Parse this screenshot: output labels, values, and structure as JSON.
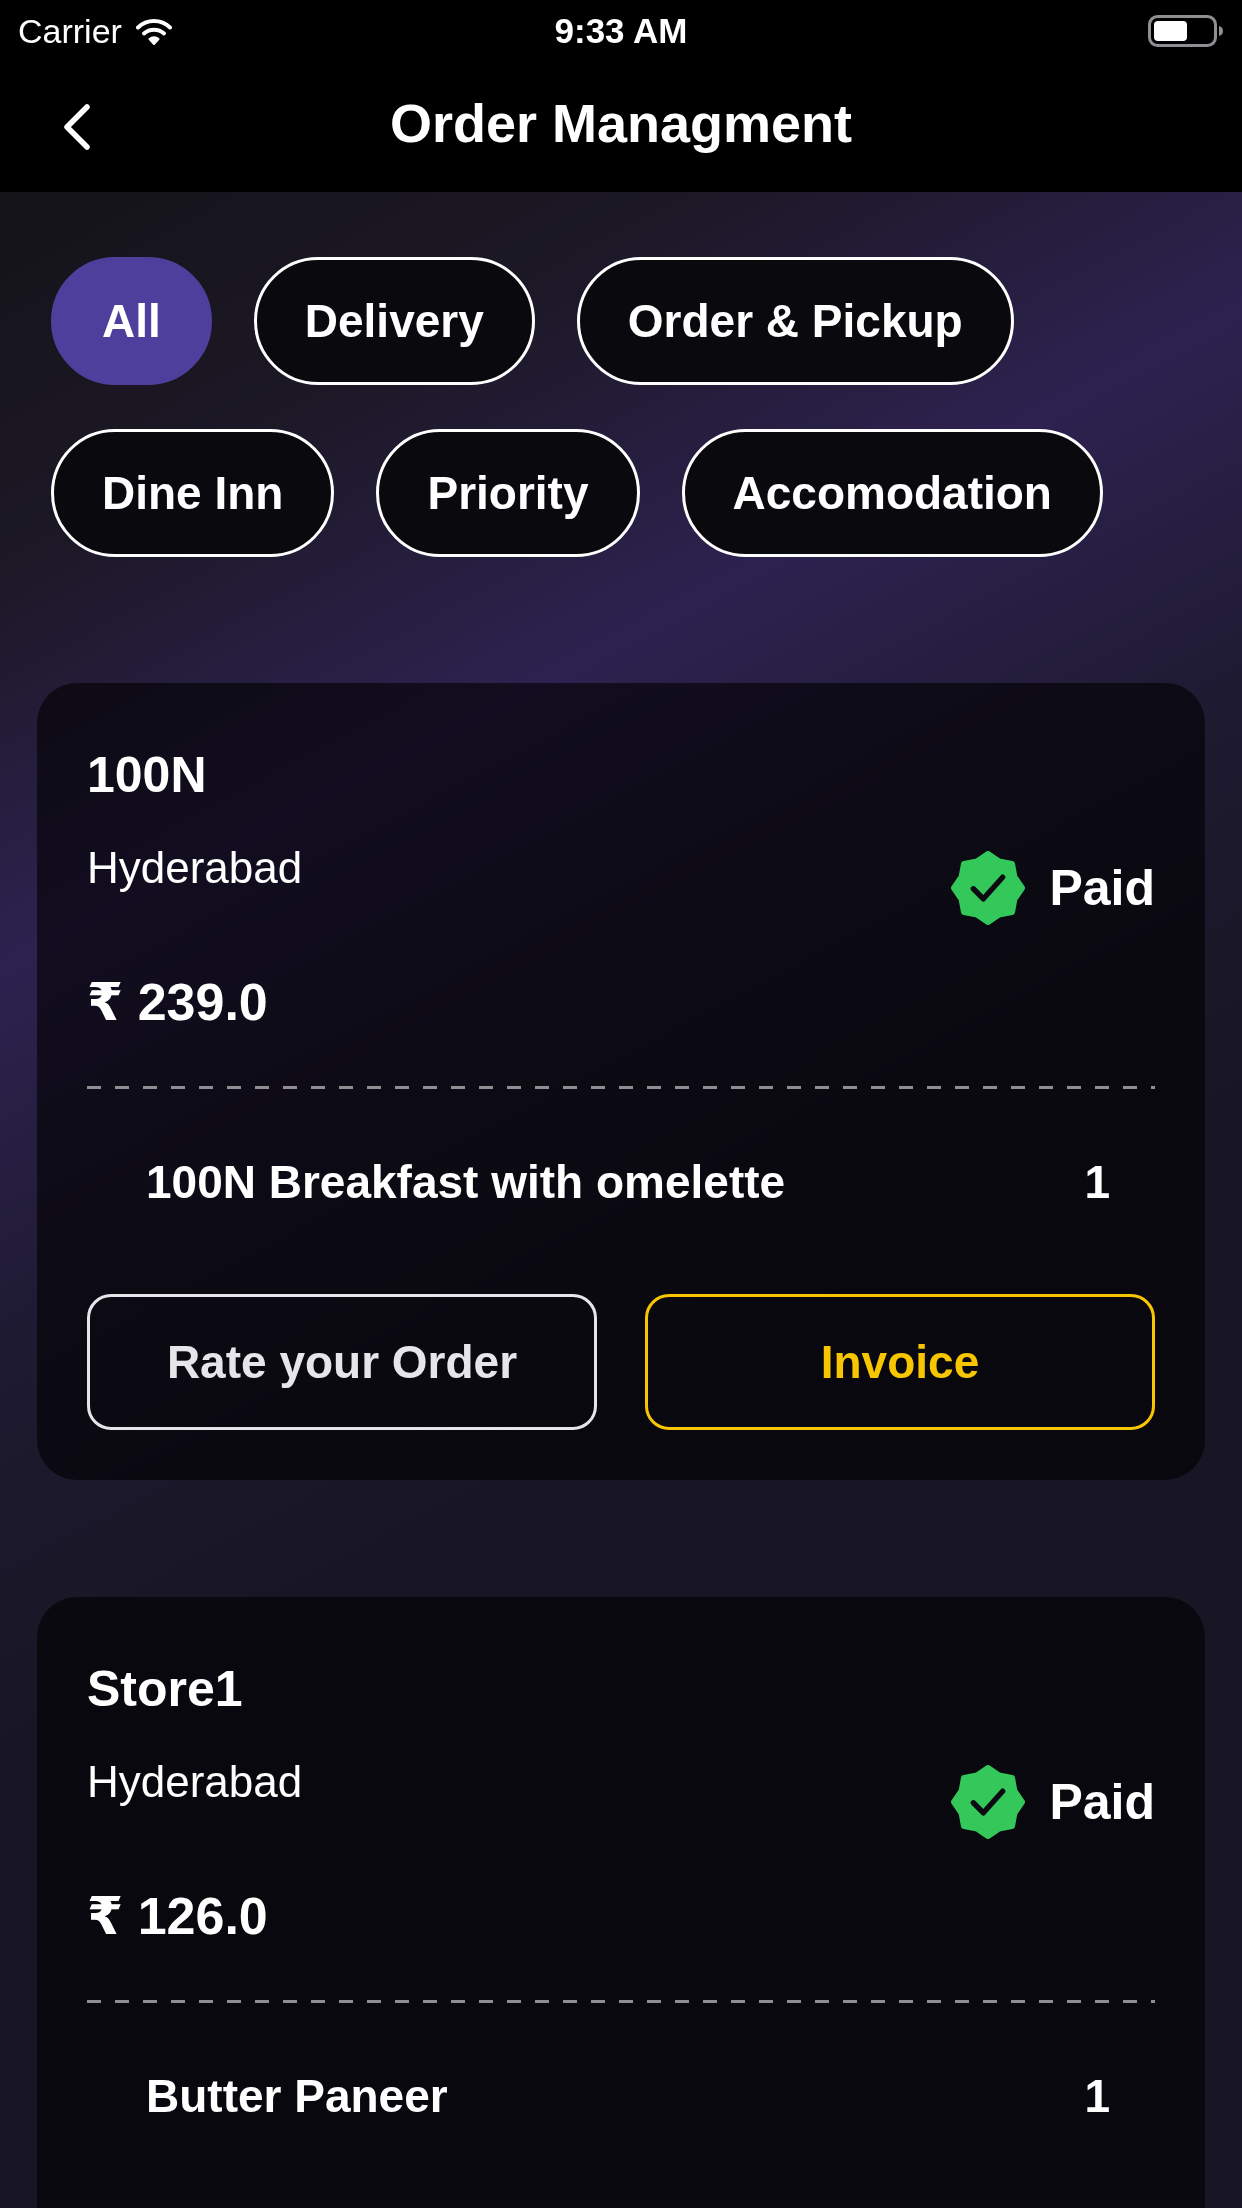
{
  "status_bar": {
    "carrier": "Carrier",
    "time": "9:33 AM"
  },
  "nav_bar": {
    "title": "Order Managment"
  },
  "filters": [
    {
      "label": "All",
      "selected": true
    },
    {
      "label": "Delivery",
      "selected": false
    },
    {
      "label": "Order & Pickup",
      "selected": false
    },
    {
      "label": "Dine Inn",
      "selected": false
    },
    {
      "label": "Priority",
      "selected": false
    },
    {
      "label": "Accomodation",
      "selected": false
    }
  ],
  "orders": [
    {
      "store": "100N",
      "city": "Hyderabad",
      "paid": true,
      "status": "Paid",
      "amount": "₹ 239.0",
      "items": [
        {
          "name": "100N Breakfast with omelette",
          "quantity": "1"
        }
      ],
      "actions": [
        {
          "label": "Rate your Order",
          "kind": "rate"
        },
        {
          "label": "Invoice",
          "kind": "invoice"
        }
      ]
    },
    {
      "store": "Store1",
      "city": "Hyderabad",
      "paid": true,
      "status": "Paid",
      "amount": "₹ 126.0",
      "items": [
        {
          "name": "Butter Paneer",
          "quantity": "1"
        }
      ]
    }
  ]
}
